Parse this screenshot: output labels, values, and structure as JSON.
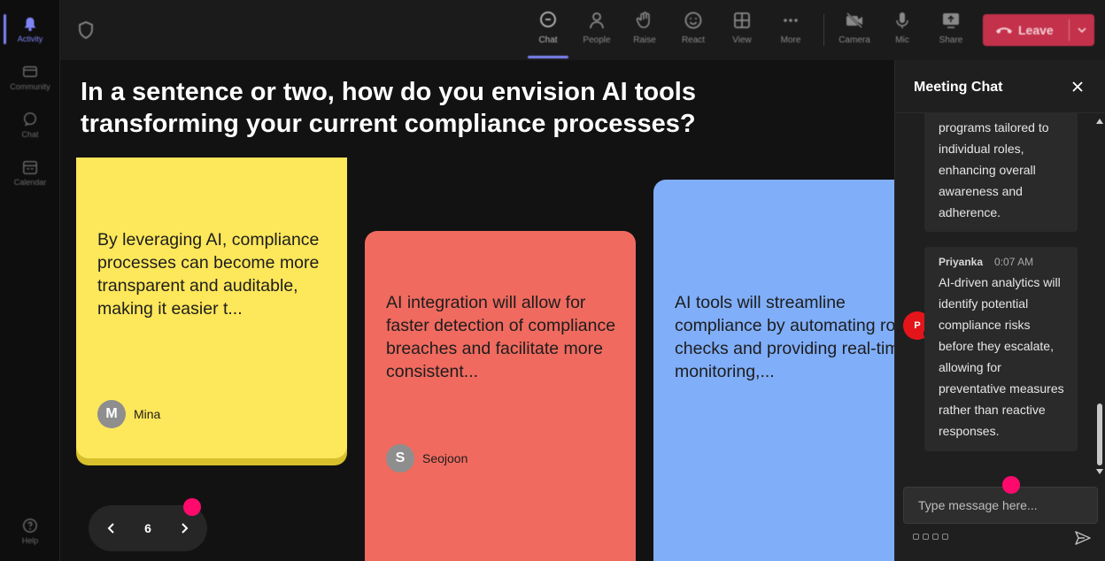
{
  "rail": {
    "items": [
      {
        "label": "Activity",
        "icon": "bell-icon"
      },
      {
        "label": "Community",
        "icon": "community-icon"
      },
      {
        "label": "Chat",
        "icon": "chat-icon"
      },
      {
        "label": "Calendar",
        "icon": "calendar-icon"
      },
      {
        "label": "Help",
        "icon": "help-icon"
      }
    ]
  },
  "toolbar": {
    "chat": "Chat",
    "people": "People",
    "raise": "Raise",
    "react": "React",
    "view": "View",
    "more": "More",
    "camera": "Camera",
    "mic": "Mic",
    "share": "Share",
    "leave": "Leave"
  },
  "stage": {
    "question": "In a sentence or two, how do you envision AI tools transforming your current compliance processes?",
    "cards": [
      {
        "text": "By leveraging AI, compliance processes can become more transparent and auditable, making it easier t...",
        "author": "Mina",
        "initial": "M",
        "color": "#fde75a"
      },
      {
        "text": "AI integration will allow for faster detection of compliance breaches and facilitate more consistent...",
        "author": "Seojoon",
        "initial": "S",
        "color": "#f06a5f"
      },
      {
        "text": "AI tools will streamline compliance by automating routine checks and providing real-time monitoring,...",
        "color": "#80aef9"
      }
    ],
    "page": "6"
  },
  "chat": {
    "title": "Meeting Chat",
    "messages": [
      {
        "text": "programs tailored to individual roles, enhancing overall awareness and adherence."
      },
      {
        "author": "Priyanka",
        "time": "0:07 AM",
        "initial": "P",
        "text": "AI-driven analytics will identify potential compliance risks before they escalate, allowing for preventative measures rather than reactive responses."
      }
    ],
    "input_placeholder": "Type message here..."
  },
  "colors": {
    "accent": "#7f85f5",
    "leave": "#c4314b",
    "highlight_dot": "#ff0a6c",
    "avatar_priyanka": "#e3151a"
  }
}
